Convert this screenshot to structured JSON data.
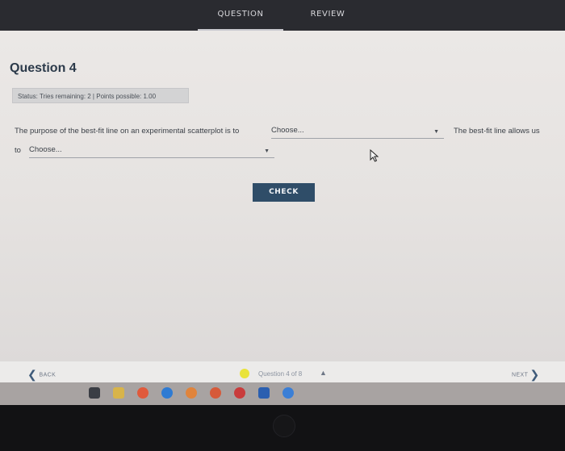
{
  "tabs": {
    "question": "QUESTION",
    "review": "REVIEW"
  },
  "question": {
    "title": "Question 4",
    "status": "Status: Tries remaining: 2 | Points possible: 1.00",
    "sentence_part1": "The purpose of the best-fit line on an experimental scatterplot is to",
    "select1_value": "Choose...",
    "sentence_part2": "The best-fit line allows us",
    "sentence_part3": "to",
    "select2_value": "Choose...",
    "check_label": "CHECK"
  },
  "nav": {
    "back_label": "BACK",
    "next_label": "NEXT",
    "question_counter": "Question 4 of 8"
  },
  "taskbar": {
    "icons": [
      "task-view-icon",
      "file-explorer-icon",
      "chrome-icon",
      "edge-icon",
      "chrome-icon",
      "chrome-icon",
      "photos-icon",
      "word-icon",
      "skype-icon"
    ]
  }
}
